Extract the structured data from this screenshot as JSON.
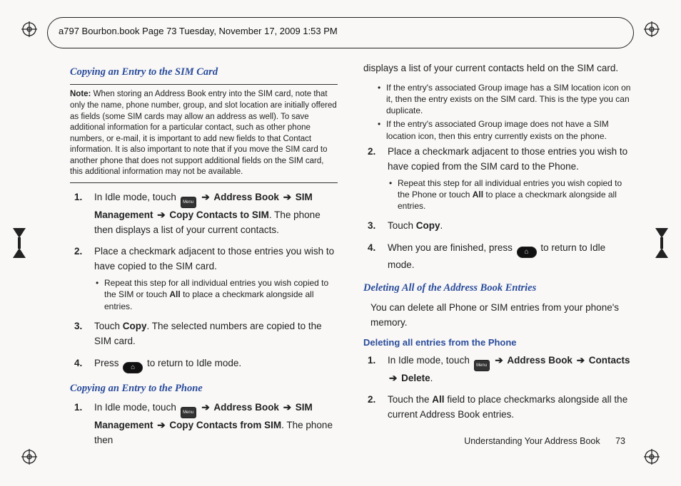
{
  "header": {
    "running": "a797 Bourbon.book  Page 73  Tuesday, November 17, 2009  1:53 PM"
  },
  "headings": {
    "copyToSim": "Copying an Entry to the SIM Card",
    "copyToPhone": "Copying an Entry to the Phone",
    "deleteAll": "Deleting All of the Address Book Entries",
    "deleteFromPhone": "Deleting all entries from the Phone"
  },
  "note": {
    "label": "Note:",
    "text": "When storing an Address Book entry into the SIM card, note that only the name, phone number, group, and slot location are initially offered as fields (some SIM cards may allow an address as well). To save additional information for a particular contact, such as other phone numbers, or e-mail, it is important to add new fields to that Contact information. It is also important to note that if you move the SIM card to another phone that does not support additional fields on the SIM card, this additional information may not be available."
  },
  "labels": {
    "arrow": "➔",
    "addressBook": "Address Book",
    "simManagement": "SIM Management",
    "copyToSim": "Copy Contacts to SIM",
    "copyFromSim": "Copy Contacts from SIM",
    "contacts": "Contacts",
    "delete": "Delete",
    "copy": "Copy",
    "all": "All",
    "idleTouch": "In Idle mode, touch ",
    "menuIcon": "Menu",
    "phoneIcon": "⌂"
  },
  "left": {
    "s1_tail": ". The phone then displays a list of your current contacts.",
    "s2": "Place a checkmark adjacent to those entries you wish to have copied to the SIM card.",
    "s2_sub": "Repeat this step for all individual entries you wish copied to the SIM or touch ",
    "s2_sub_tail": " to place a checkmark alongside all entries.",
    "s3_a": "Touch ",
    "s3_b": ". The selected numbers are copied to the SIM card.",
    "s4_a": "Press ",
    "s4_b": " to return to Idle mode.",
    "phone_s1_tail": ". The phone then"
  },
  "right": {
    "top_para": "displays a list of your current contacts held on the SIM card.",
    "sub1": "If the entry's associated Group image has a SIM location icon on it, then the entry exists on the SIM card. This is the type you can duplicate.",
    "sub2": "If the entry's associated Group image does not have a SIM location icon, then this entry currently exists on the phone.",
    "s2": "Place a checkmark adjacent to those entries you wish to have copied from the SIM card to the Phone.",
    "s2_sub": "Repeat this step for all individual entries you wish copied to the Phone or touch ",
    "s2_sub_tail": " to place a checkmark alongside all entries.",
    "s3_a": "Touch ",
    "s3_tail": ".",
    "s4_a": "When you are finished, press ",
    "s4_b": " to return to Idle mode.",
    "del_intro": "You can delete all Phone or SIM entries from your phone's memory.",
    "d1_tail": ".",
    "d2_a": "Touch the ",
    "d2_b": " field to place checkmarks alongside all the current Address Book entries."
  },
  "footer": {
    "chapter": "Understanding Your Address Book",
    "page": "73"
  }
}
